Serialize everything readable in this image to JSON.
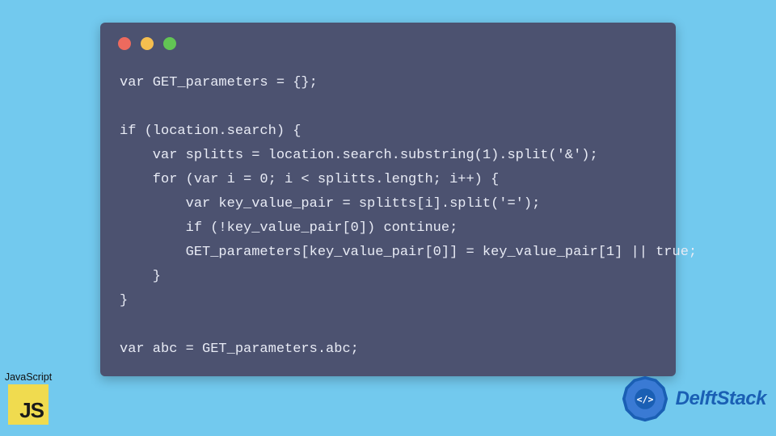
{
  "window": {
    "buttons": {
      "close_color": "#ed6a5e",
      "minimize_color": "#f5be4f",
      "zoom_color": "#62c554"
    }
  },
  "code": {
    "lines": [
      "var GET_parameters = {};",
      "",
      "if (location.search) {",
      "    var splitts = location.search.substring(1).split('&');",
      "    for (var i = 0; i < splitts.length; i++) {",
      "        var key_value_pair = splitts[i].split('=');",
      "        if (!key_value_pair[0]) continue;",
      "        GET_parameters[key_value_pair[0]] = key_value_pair[1] || true;",
      "    }",
      "}",
      "",
      "var abc = GET_parameters.abc;"
    ]
  },
  "js_badge": {
    "label": "JavaScript",
    "tile_text": "JS"
  },
  "brand": {
    "name": "DelftStack"
  }
}
